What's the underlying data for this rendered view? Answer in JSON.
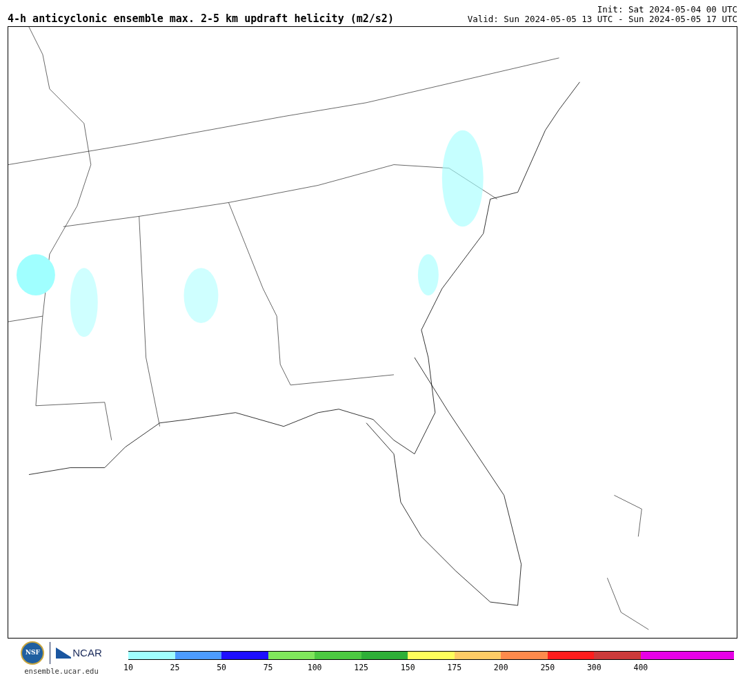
{
  "title": "4-h anticyclonic ensemble max. 2-5 km updraft helicity (m2/s2)",
  "init": "Init: Sat 2024-05-04 00 UTC",
  "valid": "Valid: Sun 2024-05-05 13 UTC - Sun 2024-05-05 17 UTC",
  "footer": {
    "nsf_logo": "NSF",
    "ncar_logo": "NCAR",
    "site": "ensemble.ucar.edu"
  },
  "legend": {
    "segments": [
      {
        "label": "10",
        "color": "#a0ffff"
      },
      {
        "label": "25",
        "color": "#4c9cff"
      },
      {
        "label": "50",
        "color": "#1e0fff"
      },
      {
        "label": "75",
        "color": "#80e65c"
      },
      {
        "label": "100",
        "color": "#4cc941"
      },
      {
        "label": "125",
        "color": "#2eaf37"
      },
      {
        "label": "150",
        "color": "#ffff5c"
      },
      {
        "label": "175",
        "color": "#ffcc66"
      },
      {
        "label": "200",
        "color": "#ff8a4c"
      },
      {
        "label": "250",
        "color": "#ff1e1e"
      },
      {
        "label": "300",
        "color": "#cc3a3a"
      },
      {
        "label": "400",
        "color": "#e600e6"
      },
      {
        "color": "#e600e6"
      }
    ]
  }
}
